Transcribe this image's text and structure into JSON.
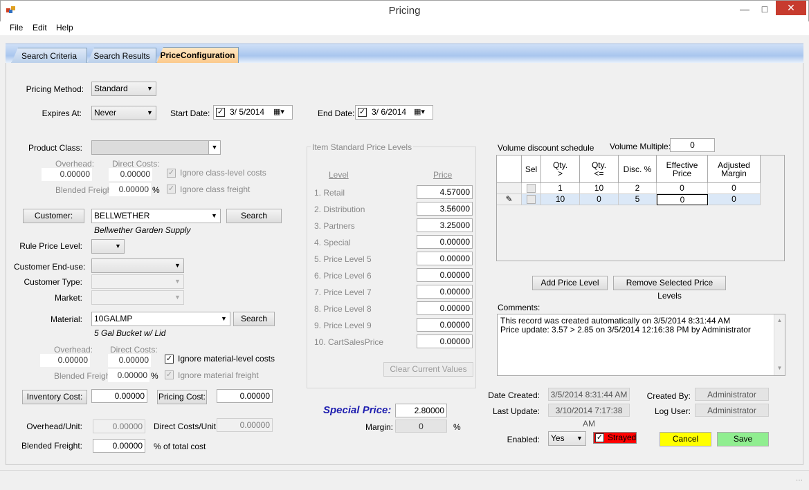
{
  "window": {
    "title": "Pricing"
  },
  "menu": [
    "File",
    "Edit",
    "Help"
  ],
  "tabs": [
    "Search Criteria",
    "Search Results",
    "PriceConfiguration"
  ],
  "pricing_method": {
    "label": "Pricing Method:",
    "value": "Standard"
  },
  "expires": {
    "label": "Expires At:",
    "value": "Never"
  },
  "start_date": {
    "label": "Start Date:",
    "value": "3/ 5/2014"
  },
  "end_date": {
    "label": "End Date:",
    "value": "3/ 6/2014"
  },
  "product_class": {
    "label": "Product Class:",
    "value": "",
    "overhead_label": "Overhead:",
    "overhead": "0.00000",
    "direct_label": "Direct Costs:",
    "direct": "0.00000",
    "ignore_costs": "Ignore class-level costs",
    "freight_label": "Blended Freight:",
    "freight": "0.00000",
    "pct": "%",
    "ignore_freight": "Ignore class freight"
  },
  "customer": {
    "button": "Customer:",
    "value": "BELLWETHER",
    "search": "Search",
    "name": "Bellwether Garden Supply",
    "rule_label": "Rule Price Level:",
    "enduse_label": "Customer End-use:",
    "type_label": "Customer Type:",
    "market_label": "Market:"
  },
  "material": {
    "label": "Material:",
    "value": "10GALMP",
    "search": "Search",
    "name": "5 Gal Bucket w/ Lid",
    "overhead_label": "Overhead:",
    "overhead": "0.00000",
    "direct_label": "Direct Costs:",
    "direct": "0.00000",
    "ignore_costs": "Ignore material-level costs",
    "freight_label": "Blended Freight:",
    "freight": "0.00000",
    "pct": "%",
    "ignore_freight": "Ignore material freight"
  },
  "costs": {
    "inventory_button": "Inventory Cost:",
    "inventory": "0.00000",
    "pricing_button": "Pricing Cost:",
    "pricing": "0.00000",
    "overhead_unit_label": "Overhead/Unit:",
    "overhead_unit": "0.00000",
    "direct_unit_label": "Direct Costs/Unit:",
    "direct_unit": "0.00000",
    "blended_label": "Blended Freight:",
    "blended": "0.00000",
    "blended_suffix": "% of total cost"
  },
  "price_levels": {
    "title": "Item Standard Price Levels",
    "col_level": "Level",
    "col_price": "Price",
    "rows": [
      {
        "label": "1.  Retail",
        "price": "4.57000"
      },
      {
        "label": "2.  Distribution",
        "price": "3.56000"
      },
      {
        "label": "3.  Partners",
        "price": "3.25000"
      },
      {
        "label": "4.  Special",
        "price": "0.00000"
      },
      {
        "label": "5.  Price Level 5",
        "price": "0.00000"
      },
      {
        "label": "6.  Price Level 6",
        "price": "0.00000"
      },
      {
        "label": "7.  Price Level 7",
        "price": "0.00000"
      },
      {
        "label": "8.  Price Level 8",
        "price": "0.00000"
      },
      {
        "label": "9.  Price Level 9",
        "price": "0.00000"
      },
      {
        "label": "10.  CartSalesPrice",
        "price": "0.00000"
      }
    ],
    "clear_button": "Clear Current Values"
  },
  "special": {
    "label": "Special Price:",
    "value": "2.80000",
    "margin_label": "Margin:",
    "margin": "0",
    "pct": "%"
  },
  "volume": {
    "title": "Volume discount schedule",
    "multiple_label": "Volume Multiple:",
    "multiple": "0",
    "headers": [
      "Sel",
      "Qty.\n>",
      "Qty.\n<=",
      "Disc. %",
      "Effective\nPrice",
      "Adjusted\nMargin"
    ],
    "rows": [
      {
        "qty_gt": "1",
        "qty_le": "10",
        "disc": "2",
        "eff": "0",
        "adj": "0"
      },
      {
        "qty_gt": "10",
        "qty_le": "0",
        "disc": "5",
        "eff": "0",
        "adj": "0"
      }
    ],
    "add_button": "Add Price Level",
    "remove_button": "Remove Selected Price Levels"
  },
  "comments": {
    "label": "Comments:",
    "lines": [
      "This record was created automatically on 3/5/2014 8:31:44 AM",
      "Price update: 3.57 > 2.85 on 3/5/2014 12:16:38 PM by Administrator"
    ]
  },
  "audit": {
    "created_label": "Date Created:",
    "created": "3/5/2014 8:31:44 AM",
    "updated_label": "Last Update:",
    "updated": "3/10/2014 7:17:38 AM",
    "created_by_label": "Created By:",
    "created_by": "Administrator",
    "log_user_label": "Log User:",
    "log_user": "Administrator"
  },
  "footer": {
    "enabled_label": "Enabled:",
    "enabled": "Yes",
    "strayed": "Strayed",
    "cancel": "Cancel",
    "save": "Save",
    "colors": {
      "strayed": "#ff0000",
      "cancel": "#ffff00",
      "save": "#90ee90",
      "special_price": "#1f1fb0"
    }
  }
}
